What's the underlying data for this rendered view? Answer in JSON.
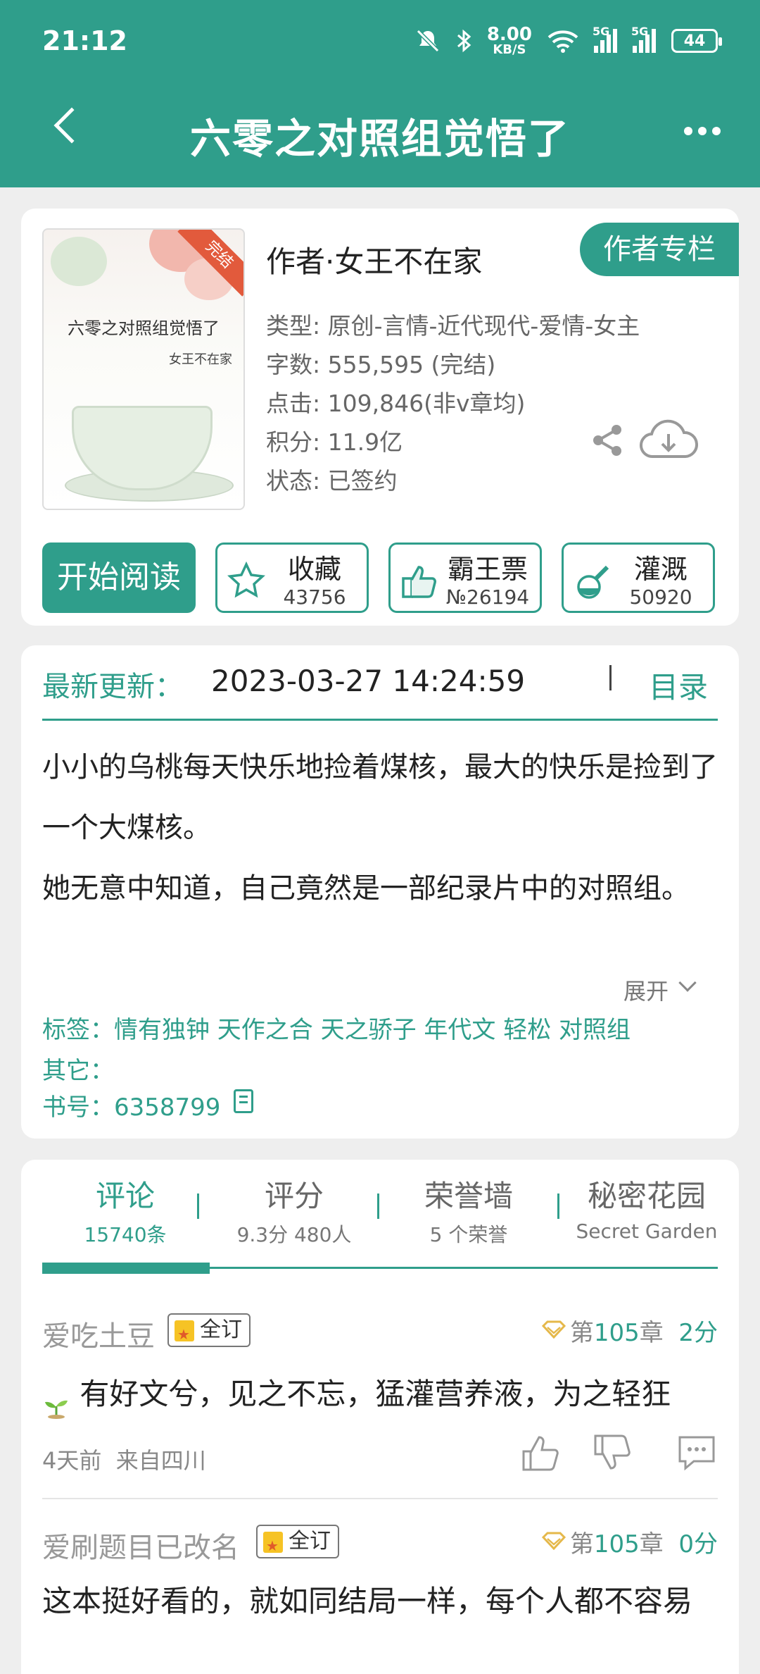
{
  "status_bar": {
    "time": "21:12",
    "net_speed_value": "8.00",
    "net_speed_unit": "KB/S",
    "sig1": "5G",
    "sig2": "5G",
    "battery": "44"
  },
  "header": {
    "title": "六零之对照组觉悟了"
  },
  "book": {
    "cover_title": "六零之对照组觉悟了",
    "cover_author": "女王不在家",
    "cover_ribbon": "完结",
    "author": "作者·女王不在家",
    "author_column_label": "作者专栏",
    "type": "类型: 原创-言情-近代现代-爱情-女主",
    "words": "字数: 555,595 (完结)",
    "clicks": "点击: 109,846(非v章均)",
    "points": "积分: 11.9亿",
    "status": "状态: 已签约"
  },
  "actions": {
    "read_label": "开始阅读",
    "collect": {
      "label": "收藏",
      "count": "43756"
    },
    "bawang": {
      "label": "霸王票",
      "count": "№26194"
    },
    "irrigate": {
      "label": "灌溉",
      "count": "50920"
    }
  },
  "update": {
    "label": "最新更新：",
    "time": "2023-03-27 14:24:59",
    "catalog_label": "目录",
    "summary_1": "小小的乌桃每天快乐地捡着煤核，最大的快乐是捡到了一个大煤核。",
    "summary_2": "她无意中知道，自己竟然是一部纪录片中的对照组。",
    "expand_label": "展开",
    "tags": "标签：情有独钟 天作之合 天之骄子 年代文 轻松 对照组",
    "other": "其它：",
    "book_no": "书号：6358799"
  },
  "tabs": [
    {
      "title": "评论",
      "sub": "15740条"
    },
    {
      "title": "评分",
      "sub": "9.3分 480人"
    },
    {
      "title": "荣誉墙",
      "sub": "5 个荣誉"
    },
    {
      "title": "秘密花园",
      "sub": "Secret Garden"
    }
  ],
  "comments": [
    {
      "user": "爱吃土豆",
      "badge": "全订",
      "chapter_prefix": "第",
      "chapter_num": "105",
      "chapter_suffix": "章",
      "score": "2分",
      "text": "有好文兮，见之不忘，猛灌营养液，为之轻狂",
      "time": "4天前",
      "location": "来自四川"
    },
    {
      "user": "爱刷题目已改名",
      "badge": "全订",
      "chapter_prefix": "第",
      "chapter_num": "105",
      "chapter_suffix": "章",
      "score": "0分",
      "text": "这本挺好看的，就如同结局一样，每个人都不容易"
    }
  ],
  "colors": {
    "accent": "#2f9e8b",
    "background": "#eeeeee",
    "card": "#ffffff"
  }
}
